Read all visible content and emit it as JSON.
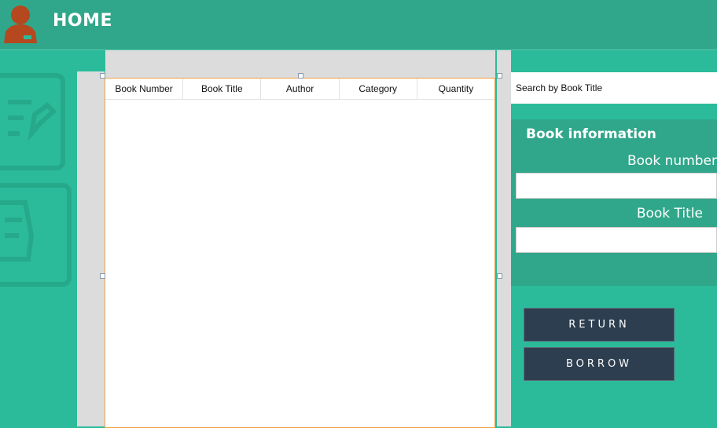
{
  "header": {
    "title": "HOME",
    "avatar_icon": "user-avatar-icon"
  },
  "table": {
    "columns": [
      "Book Number",
      "Book Title",
      "Author",
      "Category",
      "Quantity"
    ],
    "rows": []
  },
  "search": {
    "value": "Search by Book Title"
  },
  "info_panel": {
    "title": "Book information",
    "book_number_label": "Book number",
    "book_number_value": "",
    "book_title_label": "Book Title",
    "book_title_value": ""
  },
  "buttons": {
    "return_label": "RETURN",
    "borrow_label": "BORROW"
  },
  "colors": {
    "header_bg": "#30a78a",
    "body_bg": "#2bbb9a",
    "button_bg": "#2d3e50",
    "avatar": "#b5481f",
    "selection_border": "#f0a040"
  },
  "decorative_icons": [
    "edit-document-icon",
    "notebook-icon"
  ]
}
